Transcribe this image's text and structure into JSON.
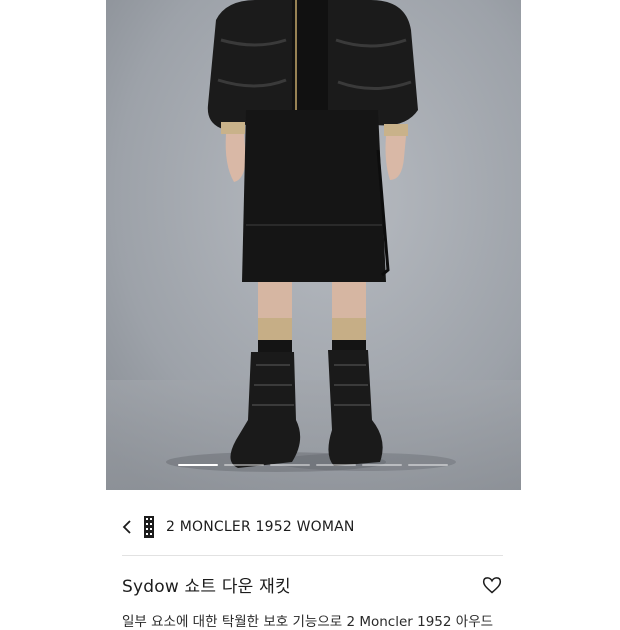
{
  "product_image": {
    "alt_subject": "model-wearing-down-jacket-skirt-boots",
    "carousel_count": 6,
    "carousel_active": 0
  },
  "breadcrumb": {
    "collection_label": "2 MONCLER 1952 WOMAN"
  },
  "product": {
    "title": "Sydow 쇼트 다운 재킷",
    "description": "일부 요소에 대한 탁월한 보호 기능으로 2 Moncler 1952 아우드"
  },
  "colors": {
    "background": "#ffffff",
    "photo_bg": "#a9adb3",
    "text": "#1c1c1c",
    "divider": "#e2e2e2"
  },
  "icons": {
    "back": "chevron-left-icon",
    "collection": "moncler-genius-icon",
    "wishlist": "heart-icon"
  }
}
